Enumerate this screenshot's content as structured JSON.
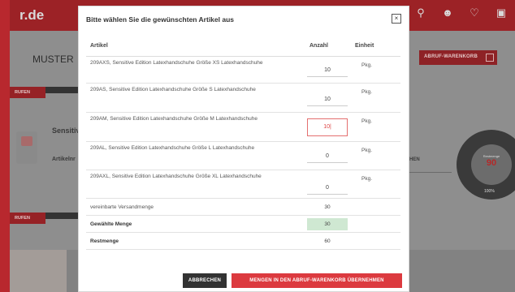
{
  "background": {
    "logo": "r.de",
    "header_icons": [
      "search-icon",
      "user-icon",
      "heart-icon",
      "cart-icon"
    ],
    "muster": "MUSTER",
    "abruf_warenkorb": "ABRUF-WARENKORB",
    "abrufen_tag_1": "RUFEN",
    "abrufen_tag_2": "RUFEN",
    "sensitiv": "Sensitiv",
    "artikelnr": "Artikelnr",
    "sehen": "SEHEN",
    "restmenge_label": "Restmenge",
    "restmenge_value": "90",
    "percent": "100%"
  },
  "modal": {
    "title": "Bitte wählen Sie die gewünschten Artikel aus",
    "close": "×",
    "headers": {
      "artikel": "Artikel",
      "anzahl": "Anzahl",
      "einheit": "Einheit"
    },
    "rows": [
      {
        "name": "209AXS, Sensitive Edition Latexhandschuhe Größe XS Latexhandschuhe",
        "qty": "10",
        "unit": "Pkg."
      },
      {
        "name": "209AS, Sensitive Edition Latexhandschuhe Größe S Latexhandschuhe",
        "qty": "10",
        "unit": "Pkg."
      },
      {
        "name": "209AM, Sensitive Edition Latexhandschuhe Größe M Latexhandschuhe",
        "qty": "10|",
        "unit": "Pkg."
      },
      {
        "name": "209AL, Sensitive Edition Latexhandschuhe Größe L Latexhandschuhe",
        "qty": "0",
        "unit": "Pkg."
      },
      {
        "name": "209AXL, Sensitive Edition Latexhandschuhe Größe XL Latexhandschuhe",
        "qty": "0",
        "unit": "Pkg."
      }
    ],
    "summary": {
      "vereinbarte_label": "vereinbarte Versandmenge",
      "vereinbarte_value": "30",
      "gewaehlte_label": "Gewählte Menge",
      "gewaehlte_value": "30",
      "rest_label": "Restmenge",
      "rest_value": "60"
    },
    "buttons": {
      "cancel": "ABBRECHEN",
      "submit": "MENGEN IN DEN ABRUF-WARENKORB ÜBERNEHMEN"
    }
  },
  "colors": {
    "accent": "#dc3a3f",
    "green": "#cfe8d2",
    "dark": "#333333"
  }
}
